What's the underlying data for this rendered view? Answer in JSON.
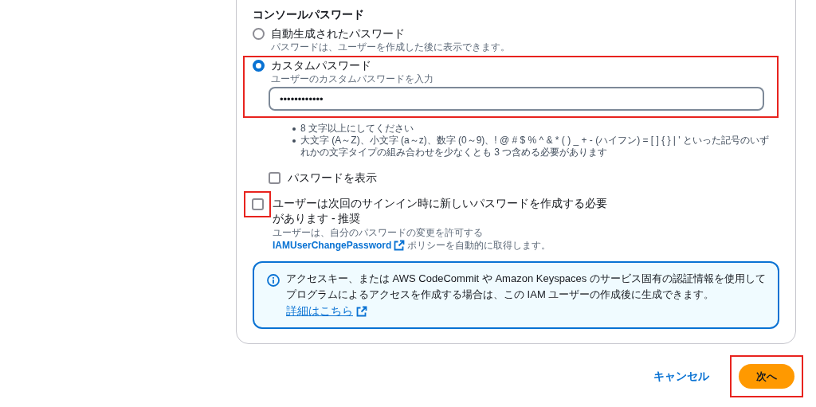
{
  "section_title": "コンソールパスワード",
  "password_options": [
    {
      "label": "自動生成されたパスワード",
      "description": "パスワードは、ユーザーを作成した後に表示できます。",
      "selected": false,
      "highlighted": false
    },
    {
      "label": "カスタムパスワード",
      "description": "ユーザーのカスタムパスワードを入力",
      "selected": true,
      "highlighted": true,
      "field_value": "••••••••••••"
    }
  ],
  "requirements": [
    "8 文字以上にしてください",
    "大文字 (A～Z)、小文字 (a～z)、数字 (0～9)、! @ # $ % ^ & * ( ) _ + - (ハイフン) = [ ] { } | ' といった記号のいずれかの文字タイプの組み合わせを少なくとも 3 つ含める必要があります"
  ],
  "show_password": {
    "label": "パスワードを表示",
    "checked": false
  },
  "reset_required": {
    "label": "ユーザーは次回のサインイン時に新しいパスワードを作成する必要があります - 推奨",
    "checked": false,
    "highlighted": true,
    "description": "ユーザーは、自分のパスワードの変更を許可する",
    "policy_link": "IAMUserChangePassword",
    "policy_suffix": "ポリシーを自動的に取得します。"
  },
  "info": {
    "text": "アクセスキー、または AWS CodeCommit や Amazon Keyspaces のサービス固有の認証情報を使用してプログラムによるアクセスを作成する場合は、この IAM ユーザーの作成後に生成できます。",
    "link": "詳細はこちら"
  },
  "buttons": {
    "cancel": "キャンセル",
    "next": "次へ",
    "next_highlighted": true
  }
}
